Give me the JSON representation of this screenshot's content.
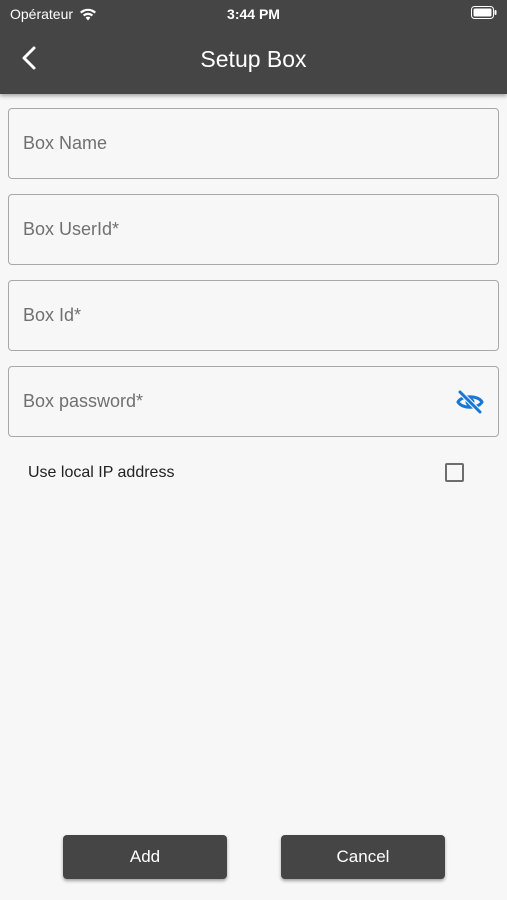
{
  "status_bar": {
    "carrier": "Opérateur",
    "time": "3:44 PM"
  },
  "header": {
    "title": "Setup Box",
    "back_icon": "chevron-left-icon"
  },
  "form": {
    "box_name_placeholder": "Box Name",
    "box_userid_placeholder": "Box UserId*",
    "box_id_placeholder": "Box Id*",
    "box_password_placeholder": "Box password*",
    "password_toggle_icon": "eye-off-icon",
    "use_local_ip_label": "Use local IP address",
    "use_local_ip_checked": false
  },
  "actions": {
    "add_label": "Add",
    "cancel_label": "Cancel"
  },
  "colors": {
    "header_bg": "#454545",
    "accent_icon": "#1976d2",
    "background": "#f7f7f7"
  }
}
